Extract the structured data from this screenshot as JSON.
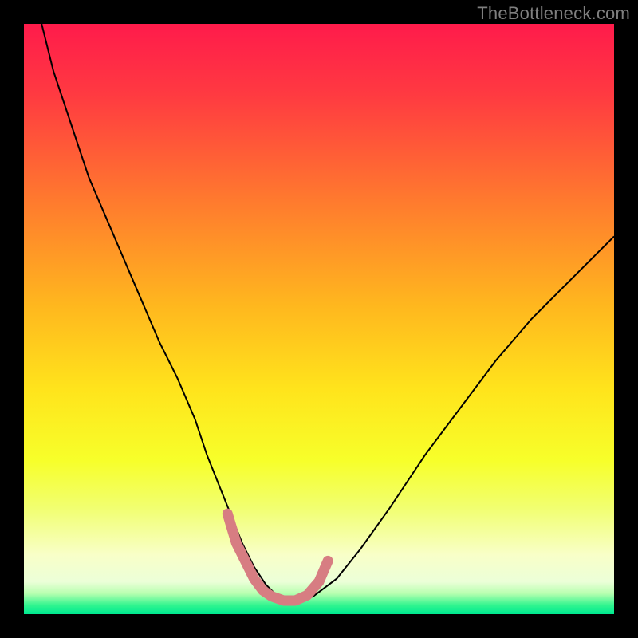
{
  "watermark": "TheBottleneck.com",
  "chart_data": {
    "type": "line",
    "title": "",
    "xlabel": "",
    "ylabel": "",
    "xlim": [
      0,
      100
    ],
    "ylim": [
      0,
      100
    ],
    "background_gradient": {
      "stops": [
        {
          "pct": 0.0,
          "color": "#ff1b4b"
        },
        {
          "pct": 0.12,
          "color": "#ff3a41"
        },
        {
          "pct": 0.3,
          "color": "#ff7a2e"
        },
        {
          "pct": 0.48,
          "color": "#ffb81e"
        },
        {
          "pct": 0.62,
          "color": "#ffe41c"
        },
        {
          "pct": 0.74,
          "color": "#f7ff2a"
        },
        {
          "pct": 0.82,
          "color": "#f1ff70"
        },
        {
          "pct": 0.9,
          "color": "#f8ffc8"
        },
        {
          "pct": 0.945,
          "color": "#ecffd8"
        },
        {
          "pct": 0.965,
          "color": "#b8ffb0"
        },
        {
          "pct": 0.985,
          "color": "#30f58f"
        },
        {
          "pct": 1.0,
          "color": "#00e990"
        }
      ]
    },
    "series": [
      {
        "name": "curve",
        "color": "#000000",
        "stroke_width": 2,
        "x": [
          3,
          5,
          8,
          11,
          14,
          17,
          20,
          23,
          26,
          29,
          31,
          33,
          35,
          37,
          39,
          41,
          43,
          46,
          49,
          53,
          57,
          62,
          68,
          74,
          80,
          86,
          92,
          97,
          100
        ],
        "y": [
          100,
          92,
          83,
          74,
          67,
          60,
          53,
          46,
          40,
          33,
          27,
          22,
          17,
          12,
          8,
          5,
          3,
          2,
          3,
          6,
          11,
          18,
          27,
          35,
          43,
          50,
          56,
          61,
          64
        ]
      },
      {
        "name": "highlight",
        "color": "#d77d82",
        "stroke_width": 13,
        "linecap": "round",
        "x": [
          34.5,
          36,
          37.5,
          39,
          40.5,
          42,
          44,
          46,
          48,
          50,
          51.5
        ],
        "y": [
          17,
          12,
          9,
          6,
          4,
          3,
          2.3,
          2.3,
          3.2,
          5.5,
          9
        ]
      }
    ]
  }
}
